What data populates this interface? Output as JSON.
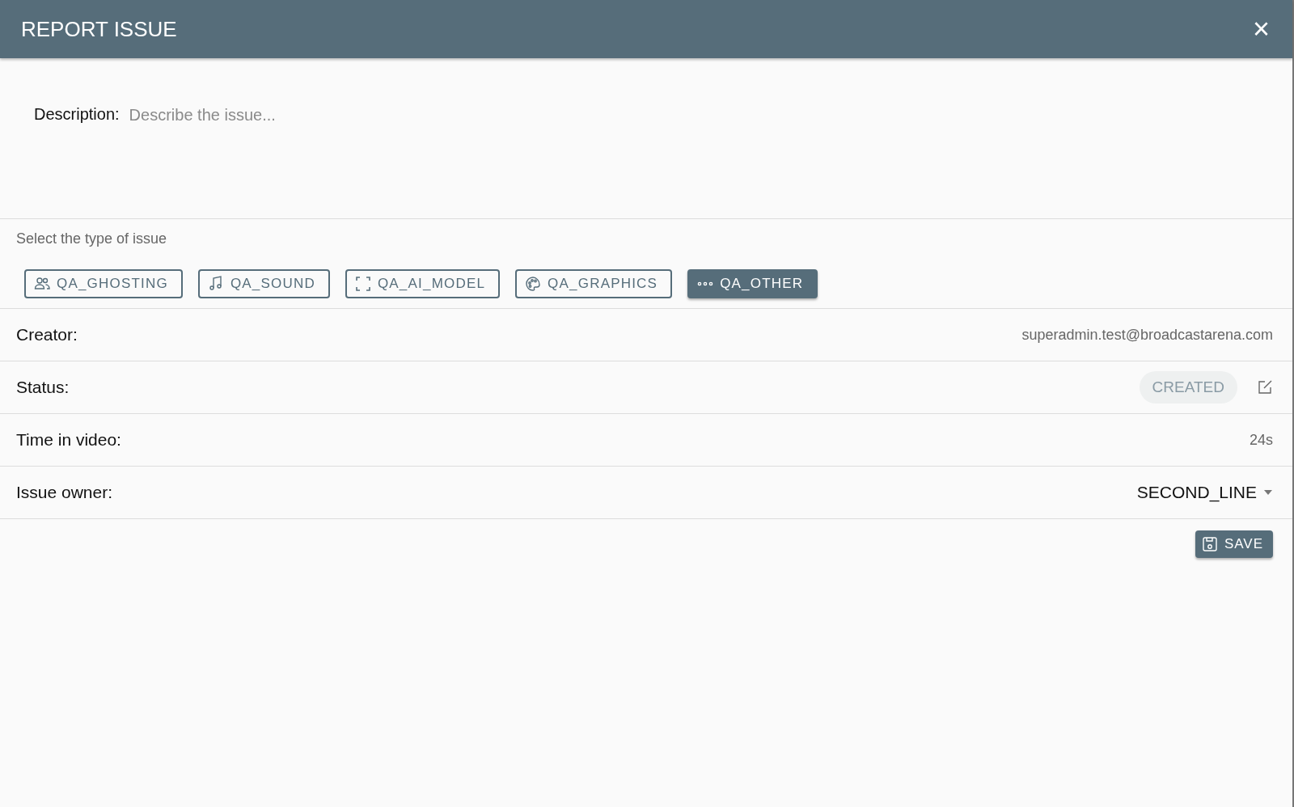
{
  "dialog": {
    "title": "REPORT ISSUE",
    "close": "×"
  },
  "description": {
    "label": "Description:",
    "placeholder": "Describe the issue..."
  },
  "issue_type": {
    "prompt": "Select the type of issue",
    "options": [
      {
        "label": "QA_GHOSTING",
        "kind": "people",
        "selected": false
      },
      {
        "label": "QA_SOUND",
        "kind": "music",
        "selected": false
      },
      {
        "label": "QA_AI_MODEL",
        "kind": "frame",
        "selected": false
      },
      {
        "label": "QA_GRAPHICS",
        "kind": "palette",
        "selected": false
      },
      {
        "label": "QA_OTHER",
        "kind": "dots",
        "selected": true
      }
    ]
  },
  "fields": [
    {
      "label": "Creator:",
      "kind": "text",
      "value": "superadmin.test@broadcastarena.com"
    },
    {
      "label": "Status:",
      "kind": "status",
      "value": "CREATED"
    },
    {
      "label": "Time in video:",
      "kind": "text",
      "value": "24s"
    },
    {
      "label": "Issue owner:",
      "kind": "select",
      "value": "SECOND_LINE"
    }
  ],
  "save_button": "SAVE"
}
